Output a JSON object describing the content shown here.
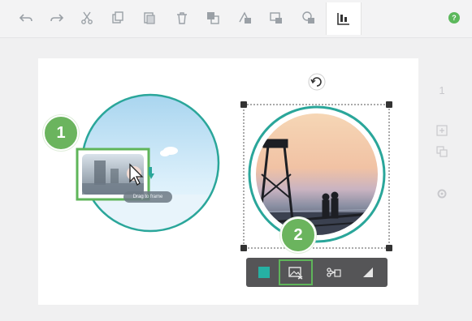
{
  "toolbar": {
    "buttons": [
      {
        "name": "undo-button",
        "icon": "undo-icon"
      },
      {
        "name": "redo-button",
        "icon": "redo-icon"
      },
      {
        "name": "cut-button",
        "icon": "scissors-icon"
      },
      {
        "name": "copy-button",
        "icon": "copy-icon"
      },
      {
        "name": "paste-button",
        "icon": "paste-icon"
      },
      {
        "name": "delete-button",
        "icon": "trash-icon"
      },
      {
        "name": "bring-forward-button",
        "icon": "layer-forward-icon"
      },
      {
        "name": "send-backward-button",
        "icon": "layer-backward-icon"
      },
      {
        "name": "bring-to-front-button",
        "icon": "layer-front-icon"
      },
      {
        "name": "send-to-back-button",
        "icon": "layer-back-icon"
      },
      {
        "name": "align-button",
        "icon": "align-icon",
        "active": true
      }
    ],
    "help_label": "?"
  },
  "canvas": {
    "step1_label": "1",
    "step2_label": "2",
    "drag_tooltip": "Drag to frame"
  },
  "right_panel": {
    "page_number": "1"
  },
  "image_toolbar": {
    "buttons": [
      {
        "name": "fill-color-button",
        "icon": "color-swatch-icon"
      },
      {
        "name": "replace-image-button",
        "icon": "replace-image-icon",
        "highlighted": true
      },
      {
        "name": "crop-detach-button",
        "icon": "crop-scissors-icon"
      },
      {
        "name": "adjust-button",
        "icon": "adjust-icon"
      }
    ]
  },
  "colors": {
    "accent_green": "#6bb45e",
    "teal_frame": "#2aa69a",
    "toolbar_bg": "#f3f3f4",
    "image_bar": "#555557"
  }
}
